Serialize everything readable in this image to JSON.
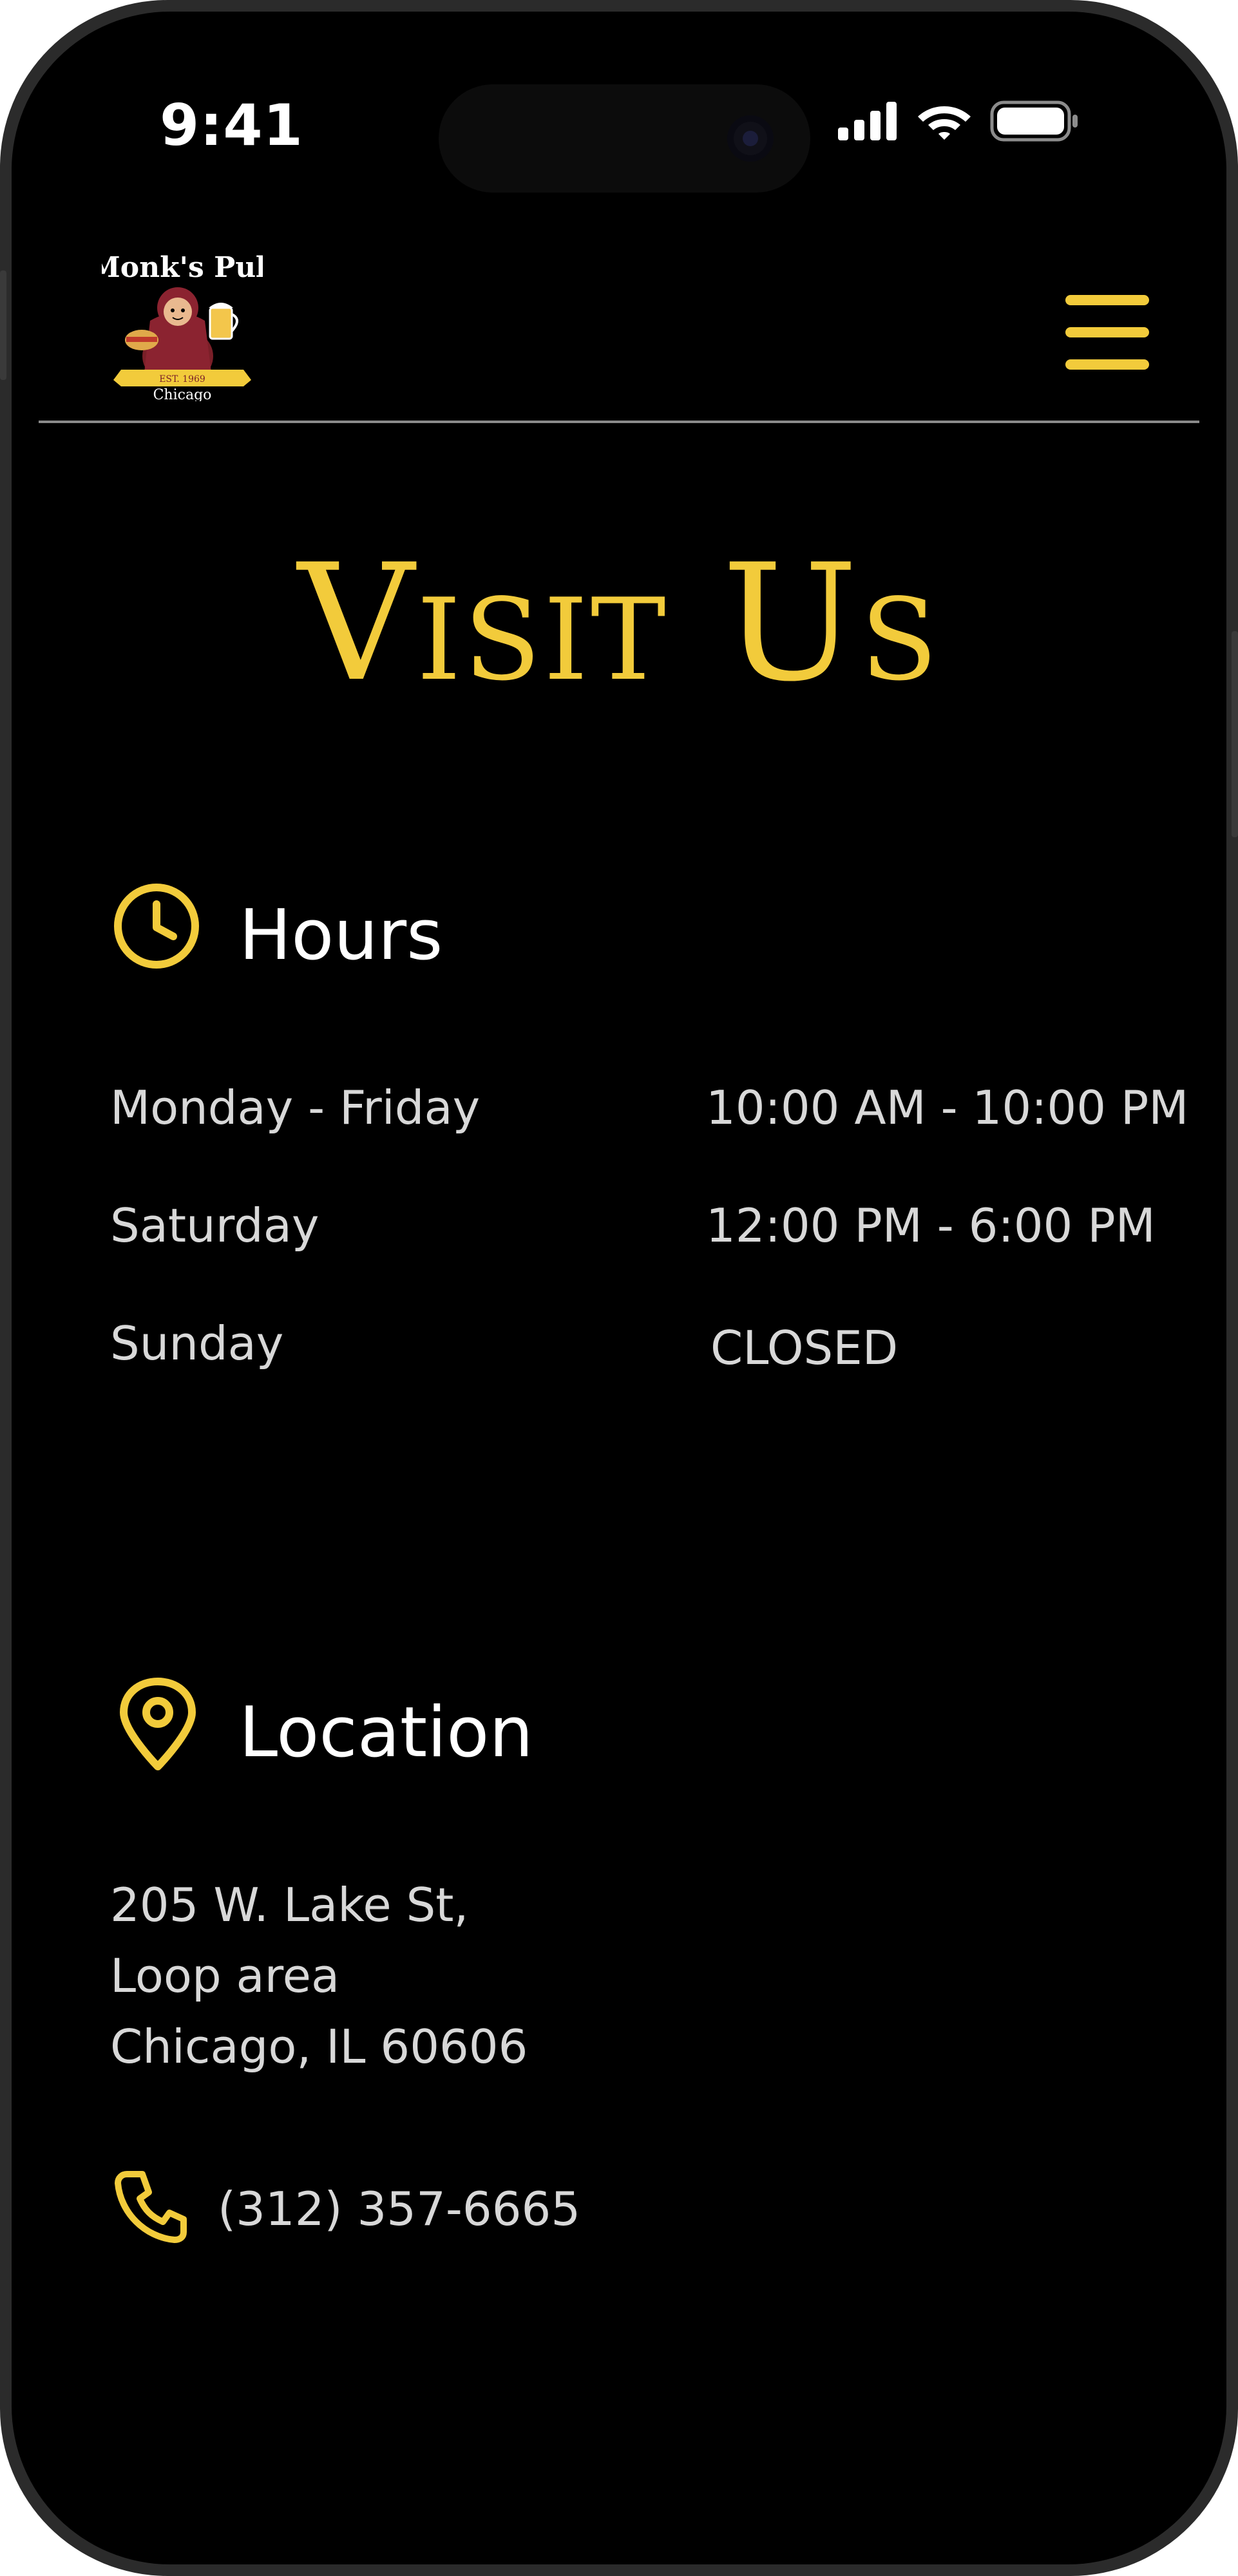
{
  "status_bar": {
    "time": "9:41"
  },
  "header": {
    "logo": {
      "title": "Monk's Pub",
      "banner": "EST. 1969",
      "city": "Chicago"
    },
    "menu_icon": "hamburger-menu-icon"
  },
  "page": {
    "title": "Visit Us"
  },
  "hours": {
    "heading": "Hours",
    "icon": "clock-icon",
    "rows": [
      {
        "day": "Monday - Friday",
        "time": "10:00 AM - 10:00 PM"
      },
      {
        "day": "Saturday",
        "time": "12:00 PM - 6:00 PM"
      },
      {
        "day": "Sunday",
        "time": "CLOSED"
      }
    ]
  },
  "location": {
    "heading": "Location",
    "icon": "map-pin-icon",
    "address_lines": [
      "205 W. Lake St,",
      "Loop area",
      "Chicago, IL 60606"
    ],
    "phone_icon": "phone-icon",
    "phone": "(312) 357-6665"
  },
  "colors": {
    "accent": "#f2cb3b",
    "background": "#000000",
    "text": "#d8d8d8",
    "heading_text": "#ffffff",
    "divider": "#8a8a8a"
  }
}
